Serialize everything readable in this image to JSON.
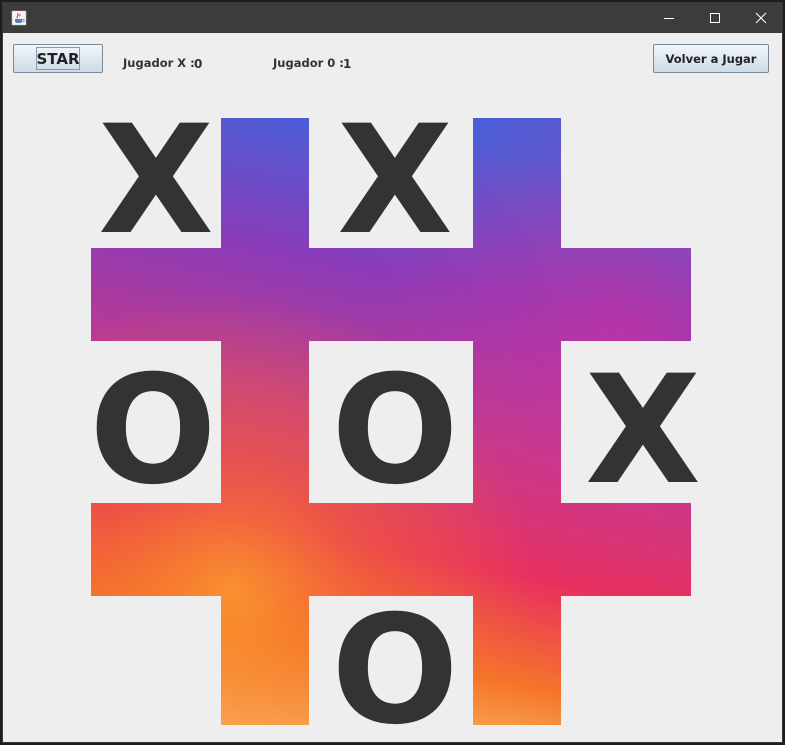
{
  "window": {
    "icon": "java-cup-icon",
    "controls": [
      "minimize-icon",
      "maximize-icon",
      "close-icon"
    ]
  },
  "toolbar": {
    "start_label": "STAR",
    "reset_label": "Volver a Jugar"
  },
  "scores": {
    "x_label": "Jugador X :",
    "x_value": "0",
    "o_label": "Jugador 0 :",
    "o_value": "1"
  },
  "board": {
    "cells": [
      "X",
      "X",
      "",
      "O",
      "O",
      "X",
      "",
      "O",
      ""
    ]
  },
  "colors": {
    "titlebar": "#3c3c3c",
    "background": "#eeeeee",
    "mark": "#333333",
    "grid_gradient": [
      "#4a5fd8",
      "#8a3bb8",
      "#c43a8a",
      "#e8305f",
      "#f5752a",
      "#fcd77a"
    ]
  }
}
